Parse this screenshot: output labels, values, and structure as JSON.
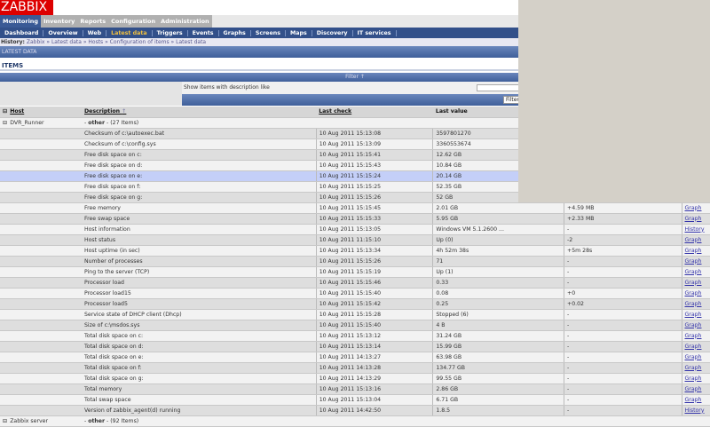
{
  "logo": "ZABBIX",
  "top_menu": [
    "Monitoring",
    "Inventory",
    "Reports",
    "Configuration",
    "Administration"
  ],
  "sub_menu": [
    "Dashboard",
    "Overview",
    "Web",
    "Latest data",
    "Triggers",
    "Events",
    "Graphs",
    "Screens",
    "Maps",
    "Discovery",
    "IT services"
  ],
  "history": {
    "label": "History:",
    "path": "Zabbix » Latest data » Hosts » Configuration of items » Latest data"
  },
  "section_title": "LATEST DATA",
  "items_title": "ITEMS",
  "filter": {
    "bar_label": "Filter",
    "field_label": "Show items with description like",
    "value": "",
    "button": "Filter"
  },
  "columns": {
    "host": "Host",
    "description": "Description",
    "last_check": "Last check",
    "last_value": "Last value"
  },
  "groups": [
    {
      "host": "DVR_Runner",
      "group": "other",
      "count": "(27 Items)"
    },
    {
      "host": "Zabbix server",
      "group": "other",
      "count": "(92 Items)"
    }
  ],
  "rows": [
    {
      "d": "Checksum of c:\\autoexec.bat",
      "t": "10 Aug 2011 15:13:08",
      "v": "3597801270",
      "c": "",
      "a": ""
    },
    {
      "d": "Checksum of c:\\config.sys",
      "t": "10 Aug 2011 15:13:09",
      "v": "3360553674",
      "c": "",
      "a": ""
    },
    {
      "d": "Free disk space on c:",
      "t": "10 Aug 2011 15:15:41",
      "v": "12.62 GB",
      "c": "",
      "a": ""
    },
    {
      "d": "Free disk space on d:",
      "t": "10 Aug 2011 15:15:43",
      "v": "10.84 GB",
      "c": "",
      "a": ""
    },
    {
      "d": "Free disk space on e:",
      "t": "10 Aug 2011 15:15:24",
      "v": "20.14 GB",
      "c": "",
      "a": ""
    },
    {
      "d": "Free disk space on f:",
      "t": "10 Aug 2011 15:15:25",
      "v": "52.35 GB",
      "c": "",
      "a": ""
    },
    {
      "d": "Free disk space on g:",
      "t": "10 Aug 2011 15:15:26",
      "v": "52 GB",
      "c": "",
      "a": ""
    },
    {
      "d": "Free memory",
      "t": "10 Aug 2011 15:15:45",
      "v": "2.01 GB",
      "c": "+4.59 MB",
      "a": "Graph"
    },
    {
      "d": "Free swap space",
      "t": "10 Aug 2011 15:15:33",
      "v": "5.95 GB",
      "c": "+2.33 MB",
      "a": "Graph"
    },
    {
      "d": "Host information",
      "t": "10 Aug 2011 15:13:05",
      "v": "Windows VM 5.1.2600 ...",
      "c": "-",
      "a": "History"
    },
    {
      "d": "Host status",
      "t": "10 Aug 2011 11:15:10",
      "v": "Up (0)",
      "c": "-2",
      "a": "Graph"
    },
    {
      "d": "Host uptime (in sec)",
      "t": "10 Aug 2011 15:13:34",
      "v": "4h 52m 38s",
      "c": "+5m 28s",
      "a": "Graph"
    },
    {
      "d": "Number of processes",
      "t": "10 Aug 2011 15:15:26",
      "v": "71",
      "c": "-",
      "a": "Graph"
    },
    {
      "d": "Ping to the server (TCP)",
      "t": "10 Aug 2011 15:15:19",
      "v": "Up (1)",
      "c": "-",
      "a": "Graph"
    },
    {
      "d": "Processor load",
      "t": "10 Aug 2011 15:15:46",
      "v": "0.33",
      "c": "-",
      "a": "Graph"
    },
    {
      "d": "Processor load15",
      "t": "10 Aug 2011 15:15:40",
      "v": "0.08",
      "c": "+0",
      "a": "Graph"
    },
    {
      "d": "Processor load5",
      "t": "10 Aug 2011 15:15:42",
      "v": "0.25",
      "c": "+0.02",
      "a": "Graph"
    },
    {
      "d": "Service state of DHCP client (Dhcp)",
      "t": "10 Aug 2011 15:15:28",
      "v": "Stopped (6)",
      "c": "-",
      "a": "Graph"
    },
    {
      "d": "Size of c:\\msdos.sys",
      "t": "10 Aug 2011 15:15:40",
      "v": "4 B",
      "c": "-",
      "a": "Graph"
    },
    {
      "d": "Total disk space on c:",
      "t": "10 Aug 2011 15:13:12",
      "v": "31.24 GB",
      "c": "-",
      "a": "Graph"
    },
    {
      "d": "Total disk space on d:",
      "t": "10 Aug 2011 15:13:14",
      "v": "15.99 GB",
      "c": "-",
      "a": "Graph"
    },
    {
      "d": "Total disk space on e:",
      "t": "10 Aug 2011 14:13:27",
      "v": "63.98 GB",
      "c": "-",
      "a": "Graph"
    },
    {
      "d": "Total disk space on f:",
      "t": "10 Aug 2011 14:13:28",
      "v": "134.77 GB",
      "c": "-",
      "a": "Graph"
    },
    {
      "d": "Total disk space on g:",
      "t": "10 Aug 2011 14:13:29",
      "v": "99.55 GB",
      "c": "-",
      "a": "Graph"
    },
    {
      "d": "Total memory",
      "t": "10 Aug 2011 15:13:16",
      "v": "2.86 GB",
      "c": "-",
      "a": "Graph"
    },
    {
      "d": "Total swap space",
      "t": "10 Aug 2011 15:13:04",
      "v": "6.71 GB",
      "c": "-",
      "a": "Graph"
    },
    {
      "d": "Version of zabbix_agent(d) running",
      "t": "10 Aug 2011 14:42:50",
      "v": "1.8.5",
      "c": "-",
      "a": "History"
    }
  ]
}
